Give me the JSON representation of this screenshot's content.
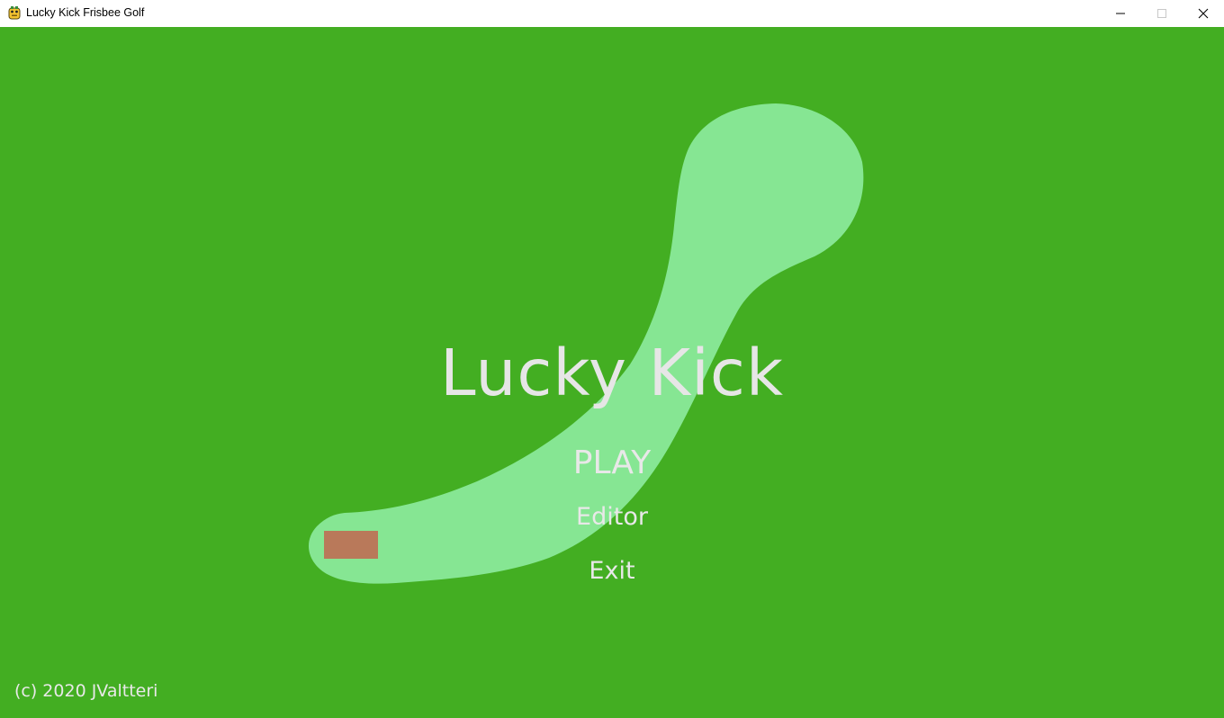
{
  "window": {
    "title": "Lucky Kick Frisbee Golf",
    "icon": "pygame-snake-icon",
    "controls": {
      "minimize_icon": "minimize-icon",
      "maximize_icon": "maximize-icon",
      "close_icon": "close-icon"
    }
  },
  "game": {
    "title": "Lucky Kick",
    "menu": {
      "play_label": "PLAY",
      "editor_label": "Editor",
      "exit_label": "Exit"
    },
    "copyright": "(c) 2020 JValtteri"
  },
  "colors": {
    "background": "#43ae22",
    "fairway": "#86e693",
    "tee_pad": "#b9795a",
    "menu_text": "#e8e8e8",
    "title_text": "#e6e6e6"
  }
}
